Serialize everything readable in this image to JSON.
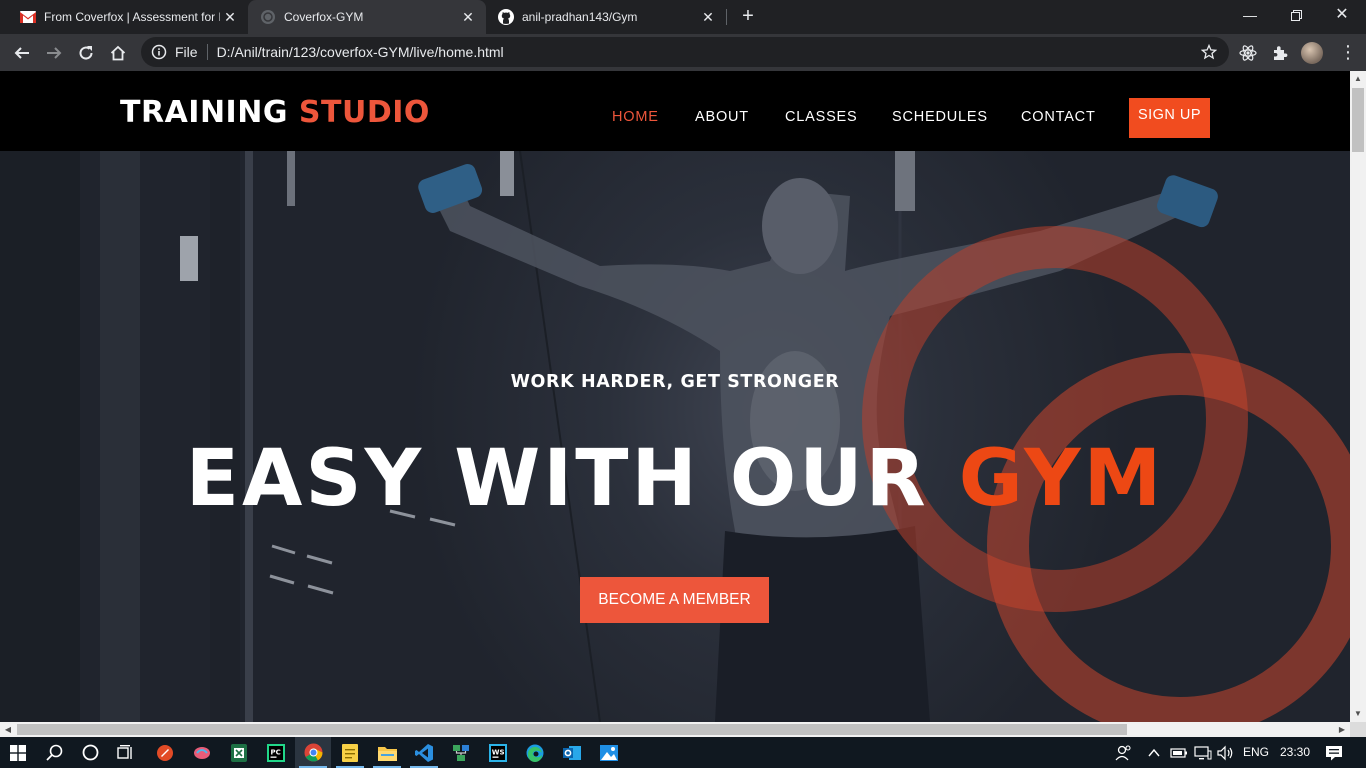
{
  "browser": {
    "tabs": [
      {
        "title": "From Coverfox | Assessment for F",
        "icon": "gmail-icon",
        "active": false
      },
      {
        "title": "Coverfox-GYM",
        "icon": "globe-icon",
        "active": true
      },
      {
        "title": "anil-pradhan143/Gym",
        "icon": "github-icon",
        "active": false
      }
    ],
    "new_tab_label": "+",
    "address": {
      "scheme_label": "File",
      "url": "D:/Anil/train/123/coverfox-GYM/live/home.html"
    }
  },
  "site": {
    "logo": {
      "primary": "TRAINING",
      "accent": "STUDIO"
    },
    "nav": [
      {
        "label": "HOME",
        "active": true
      },
      {
        "label": "ABOUT",
        "active": false
      },
      {
        "label": "CLASSES",
        "active": false
      },
      {
        "label": "SCHEDULES",
        "active": false
      },
      {
        "label": "CONTACT",
        "active": false
      }
    ],
    "signup_label": "SIGN UP",
    "hero": {
      "tagline": "WORK HARDER, GET STRONGER",
      "headline_main": "EASY WITH OUR",
      "headline_accent": "GYM",
      "cta_label": "BECOME A MEMBER"
    },
    "colors": {
      "accent": "#ed563b",
      "header_bg": "#000000"
    }
  },
  "taskbar": {
    "language": "ENG",
    "time": "23:30",
    "apps": [
      "start-icon",
      "search-icon",
      "cortana-icon",
      "task-view-icon",
      "app-icon-orange",
      "app-icon-brain",
      "excel-icon",
      "pycharm-icon",
      "chrome-icon",
      "notes-icon",
      "file-explorer-icon",
      "vscode-icon",
      "network-app-icon",
      "webstorm-icon",
      "edge-icon",
      "outlook-icon",
      "photos-icon"
    ]
  }
}
